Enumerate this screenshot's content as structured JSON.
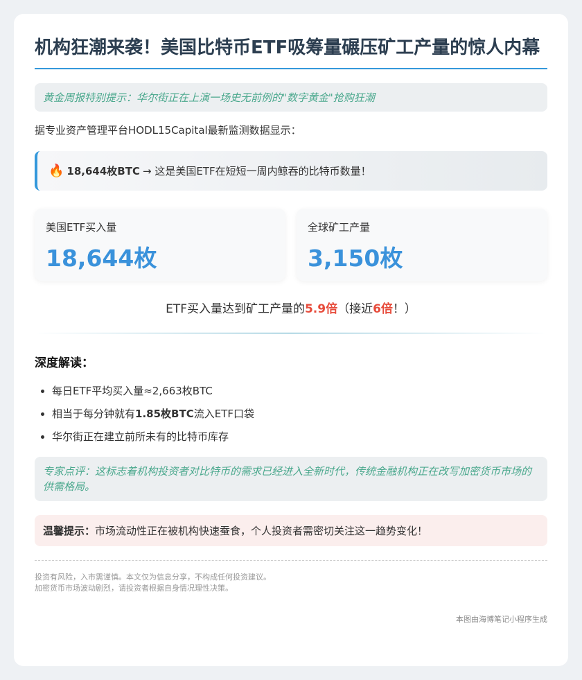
{
  "title": "机构狂潮来袭！美国比特币ETF吸筹量碾压矿工产量的惊人内幕",
  "tip": "黄金周报特别提示：华尔街正在上演一场史无前例的\"数字黄金\"抢购狂潮",
  "intro": "据专业资产管理平台HODL15Capital最新监测数据显示：",
  "highlight": {
    "icon": "fire-icon",
    "icon_glyph": "🔥",
    "strong": "18,644枚BTC",
    "text": "→ 这是美国ETF在短短一周内鲸吞的比特币数量！"
  },
  "stats": [
    {
      "label": "美国ETF买入量",
      "value": "18,644枚"
    },
    {
      "label": "全球矿工产量",
      "value": "3,150枚"
    }
  ],
  "ratio": {
    "prefix": "ETF买入量达到矿工产量的",
    "multiple": "5.9倍",
    "middle": "（接近",
    "approx": "6倍",
    "suffix": "！）"
  },
  "section_title": "深度解读：",
  "points": {
    "p1": "每日ETF平均买入量≈2,663枚BTC",
    "p2_prefix": "相当于每分钟就有",
    "p2_bold": "1.85枚BTC",
    "p2_suffix": "流入ETF口袋",
    "p3": "华尔街正在建立前所未有的比特币库存"
  },
  "expert": "专家点评：这标志着机构投资者对比特币的需求已经进入全新时代，传统金融机构正在改写加密货币市场的供需格局。",
  "warm": {
    "label": "温馨提示：",
    "text": "市场流动性正在被机构快速蚕食，个人投资者需密切关注这一趋势变化！"
  },
  "disclaimer": {
    "line1": "投资有风险，入市需谨慎。本文仅为信息分享，不构成任何投资建议。",
    "line2": "加密货币市场波动剧烈，请投资者根据自身情况理性决策。"
  },
  "credit": "本图由海博笔记小程序生成",
  "colors": {
    "accent": "#3498db",
    "value_blue": "#3a92db",
    "highlight_red": "#e74c3c",
    "tip_green": "#4aa88d"
  }
}
